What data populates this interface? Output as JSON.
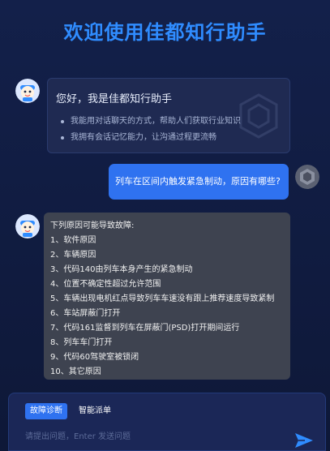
{
  "app": {
    "title": "欢迎使用佳都知行助手"
  },
  "colors": {
    "accent": "#2f8cff",
    "user_bubble": "#2f72f0",
    "answer_bubble": "#3e4350",
    "greeting_bubble": "#1f2a52",
    "background": "#0f1a3a"
  },
  "messages": {
    "greeting": {
      "heading": "您好，我是佳都知行助手",
      "points": [
        "我能用对话聊天的方式，帮助人们获取行业知识",
        "我拥有会话记忆能力，让沟通过程更流畅"
      ]
    },
    "user_question": "列车在区间内触发紧急制动，原因有哪些?",
    "answer": {
      "intro": "下列原因可能导致故障:",
      "items": [
        "1、软件原因",
        "2、车辆原因",
        "3、代码140由列车本身产生的紧急制动",
        "4、位置不确定性超过允许范围",
        "5、车辆出现电机红点导致列车车速没有跟上推荐速度导致紧制",
        "6、车站屏蔽门打开",
        "7、代码161监督到列车在屏蔽门(PSD)打开期间运行",
        "8、列车车门打开",
        "9、代码60驾驶室被锁闭",
        "10、其它原因"
      ]
    }
  },
  "input": {
    "tabs": [
      "故障诊断",
      "智能派单"
    ],
    "active_tab": 0,
    "placeholder": "请提出问题，Enter 发送问题",
    "value": ""
  },
  "icons": {
    "assistant_avatar": "robot-avatar-icon",
    "user_avatar": "user-avatar-icon",
    "send": "send-icon",
    "watermark": "hexagon-watermark-icon"
  }
}
